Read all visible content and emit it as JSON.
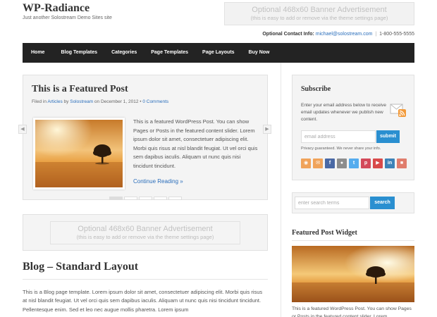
{
  "header": {
    "site_title": "WP-Radiance",
    "tagline": "Just another Solostream Demo Sites site",
    "banner_title": "Optional 468x60 Banner Advertisement",
    "banner_sub": "(this is easy to add or remove via the theme settings page)",
    "contact_label": "Optional Contact Info:",
    "contact_email": "michael@solostream.com",
    "contact_sep": "|",
    "contact_phone": "1-800-555-5555"
  },
  "nav": {
    "items": [
      {
        "label": "Home"
      },
      {
        "label": "Blog Templates"
      },
      {
        "label": "Categories"
      },
      {
        "label": "Page Templates"
      },
      {
        "label": "Page Layouts"
      },
      {
        "label": "Buy Now"
      }
    ]
  },
  "featured": {
    "title": "This is a Featured Post",
    "meta_prefix": "Filed in",
    "meta_category": "Articles",
    "meta_by": "by",
    "meta_author": "Solostream",
    "meta_on": "on December 1, 2012 •",
    "meta_comments": "0 Comments",
    "text": "This is a featured WordPress Post. You can show Pages or Posts in the featured content slider. Lorem ipsum dolor sit amet, consectetuer adipiscing elit. Morbi quis risus at nisl blandit feugiat. Ut vel orci quis sem dapibus iaculis. Aliquam ut nunc quis nisi tincidunt tincidunt.",
    "more": "Continue Reading »",
    "slide_count": 5,
    "active_slide": 1
  },
  "banner_mid": {
    "title": "Optional 468x60 Banner Advertisement",
    "sub": "(this is easy to add or remove via the theme settings page)"
  },
  "blog": {
    "title": "Blog – Standard Layout",
    "text": "This is a Blog page template. Lorem ipsum dolor sit amet, consectetuer adipiscing elit. Morbi quis risus at nisl blandit feugiat. Ut vel orci quis sem dapibus iaculis. Aliquam ut nunc quis nisi tincidunt tincidunt. Pellentesque enim. Sed et leo nec augue mollis pharetra. Lorem ipsum"
  },
  "subscribe": {
    "title": "Subscribe",
    "text": "Enter your email address below to receive email updates whenever we publish new content.",
    "email_placeholder": "email address",
    "button": "submit",
    "privacy": "Privacy guaranteed. We never share your info.",
    "social": [
      {
        "icon": "rss-icon",
        "glyph": "◉",
        "color": "#f0a35a"
      },
      {
        "icon": "email-icon",
        "glyph": "✉",
        "color": "#f0a35a"
      },
      {
        "icon": "facebook-icon",
        "glyph": "f",
        "color": "#4a69a5"
      },
      {
        "icon": "flickr-icon",
        "glyph": "●",
        "color": "#8d8d8d"
      },
      {
        "icon": "twitter-icon",
        "glyph": "t",
        "color": "#55acee"
      },
      {
        "icon": "pinterest-icon",
        "glyph": "p",
        "color": "#d34a5a"
      },
      {
        "icon": "youtube-icon",
        "glyph": "▶",
        "color": "#d84a4a"
      },
      {
        "icon": "linkedin-icon",
        "glyph": "in",
        "color": "#3d83b8"
      },
      {
        "icon": "video-icon",
        "glyph": "■",
        "color": "#e07d6d"
      }
    ]
  },
  "search": {
    "placeholder": "enter search terms",
    "button": "search"
  },
  "widget": {
    "title": "Featured Post Widget",
    "text": "This is a featured WordPress Post. You can show Pages or Posts in the featured content slider. Lorem"
  }
}
